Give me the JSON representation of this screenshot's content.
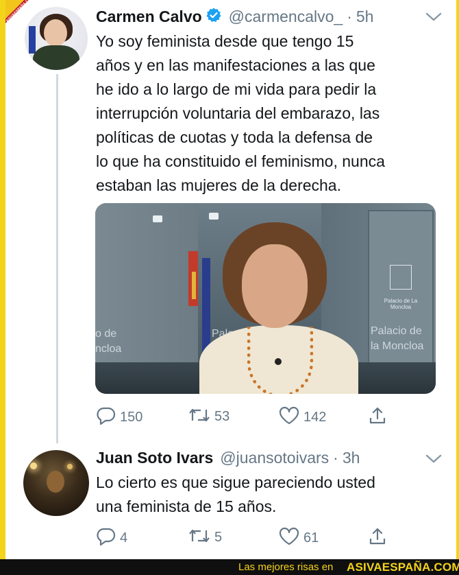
{
  "watermark": {
    "badge_text": "ASIVAESPAÑA.COM"
  },
  "tweets": [
    {
      "author_name": "Carmen Calvo",
      "verified": true,
      "handle": "@carmencalvo_",
      "separator": "·",
      "time": "5h",
      "text": "Yo soy feminista desde que tengo 15\naños y en las manifestaciones a las que\nhe ido a lo largo de mi vida para pedir la\ninterrupción voluntaria del embarazo, las\npolíticas de cuotas y toda la defensa de\nlo que ha constituido el feminismo, nunca\nestaban las mujeres de la derecha.",
      "media": {
        "wall_text_left": "o de\nncloa",
        "wall_text_mid": "Pala",
        "wall_text_right": "Palacio de\nla Moncloa",
        "panel_text": "Palacio de La Moncloa"
      },
      "actions": {
        "replies": "150",
        "retweets": "53",
        "likes": "142"
      }
    },
    {
      "author_name": "Juan Soto Ivars",
      "verified": false,
      "handle": "@juansotoivars",
      "separator": "·",
      "time": "3h",
      "text": "Lo cierto es que sigue pareciendo usted\nuna feminista de 15 años.",
      "actions": {
        "replies": "4",
        "retweets": "5",
        "likes": "61"
      }
    }
  ],
  "footer": {
    "tagline": "Las mejores risas en",
    "site": "ASIVAESPAÑA.COM"
  },
  "colors": {
    "accent": "#1da1f2",
    "text": "#14171a",
    "muted": "#657786",
    "frame": "#f4d31b"
  },
  "icons": [
    "reply-icon",
    "retweet-icon",
    "like-icon",
    "share-icon",
    "verified-icon",
    "chevron-down-icon"
  ]
}
